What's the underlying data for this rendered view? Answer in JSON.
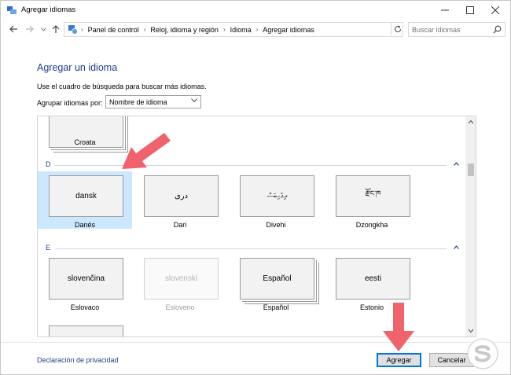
{
  "window": {
    "title": "Agregar idiomas"
  },
  "address": {
    "crumbs": [
      "Panel de control",
      "Reloj, idioma y región",
      "Idioma",
      "Agregar idiomas"
    ]
  },
  "search": {
    "placeholder": "Buscar idiomas"
  },
  "page": {
    "heading": "Agregar un idioma",
    "description": "Use el cuadro de búsqueda para buscar más idiomas.",
    "group_label": "Agrupar idiomas por:",
    "group_select_value": "Nombre de idioma"
  },
  "list": {
    "previous_tile": {
      "name": "Croata"
    },
    "groups": [
      {
        "letter": "D",
        "tiles": [
          {
            "card": "dansk",
            "name": "Danés",
            "selected": true
          },
          {
            "card": "دری",
            "name": "Dari"
          },
          {
            "card": "ދިވެހިބަސް",
            "name": "Divehi"
          },
          {
            "card": "རྫོང་ཁ",
            "name": "Dzongkha"
          }
        ]
      },
      {
        "letter": "E",
        "tiles": [
          {
            "card": "slovenčina",
            "name": "Eslovaco"
          },
          {
            "card": "slovenski",
            "name": "Esloveno",
            "disabled": true
          },
          {
            "card": "Español",
            "name": "Español"
          },
          {
            "card": "eesti",
            "name": "Estonio"
          }
        ]
      }
    ]
  },
  "footer": {
    "privacy_link": "Declaración de privacidad",
    "add_button": "Agregar",
    "cancel_button": "Cancelar"
  },
  "colors": {
    "accent": "#1e3e8c",
    "selection": "#cce8ff",
    "arrow": "#f0626c"
  }
}
